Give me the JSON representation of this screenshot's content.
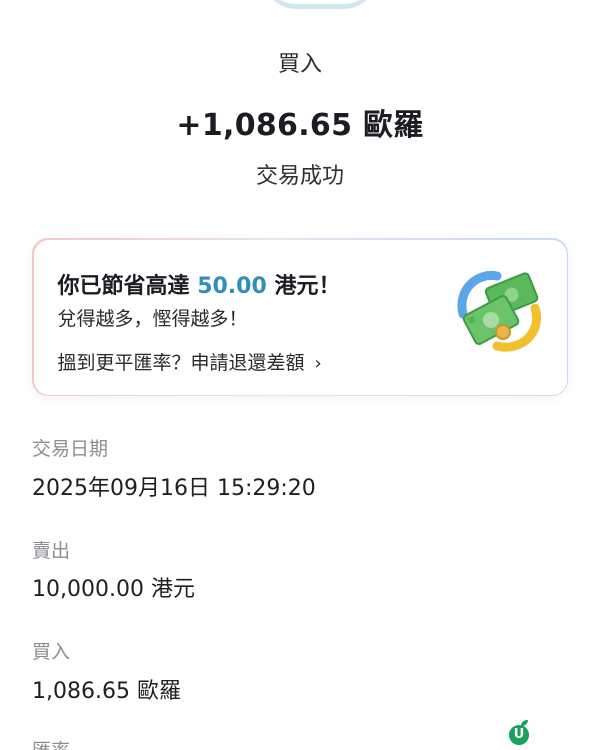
{
  "transaction": {
    "action": "買入",
    "amount": "+1,086.65 歐羅",
    "status": "交易成功"
  },
  "promo": {
    "title_prefix": "你已節省高達",
    "title_highlight": "50.00",
    "title_suffix": "港元！",
    "subtitle": "兌得越多，慳得越多！",
    "link_text": "搵到更平匯率？申請退還差額",
    "link_chevron": "›",
    "icon": "money-swap-icon",
    "highlight_color": "#2f8fb9"
  },
  "details": [
    {
      "label": "交易日期",
      "value": "2025年09月16日 15:29:20"
    },
    {
      "label": "賣出",
      "value": "10,000.00 港元"
    },
    {
      "label": "買入",
      "value": "1,086.65 歐羅"
    },
    {
      "label": "匯率",
      "value": ""
    }
  ],
  "watermark": {
    "letter": "U",
    "icon": "u-leaf-logo-icon"
  }
}
